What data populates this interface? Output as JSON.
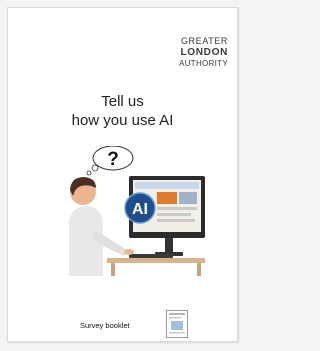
{
  "logo": {
    "line1": "GREATER",
    "line2": "LONDON",
    "line3": "AUTHORITY"
  },
  "title": {
    "line1": "Tell us",
    "line2": "how you use AI"
  },
  "illustration": {
    "bubble_symbol": "?",
    "badge_text": "AI"
  },
  "footer": {
    "label": "Survey booklet"
  },
  "colors": {
    "logo_text": "#3a3a3a",
    "badge": "#1e4f8c",
    "monitor": "#2b2b2b"
  }
}
